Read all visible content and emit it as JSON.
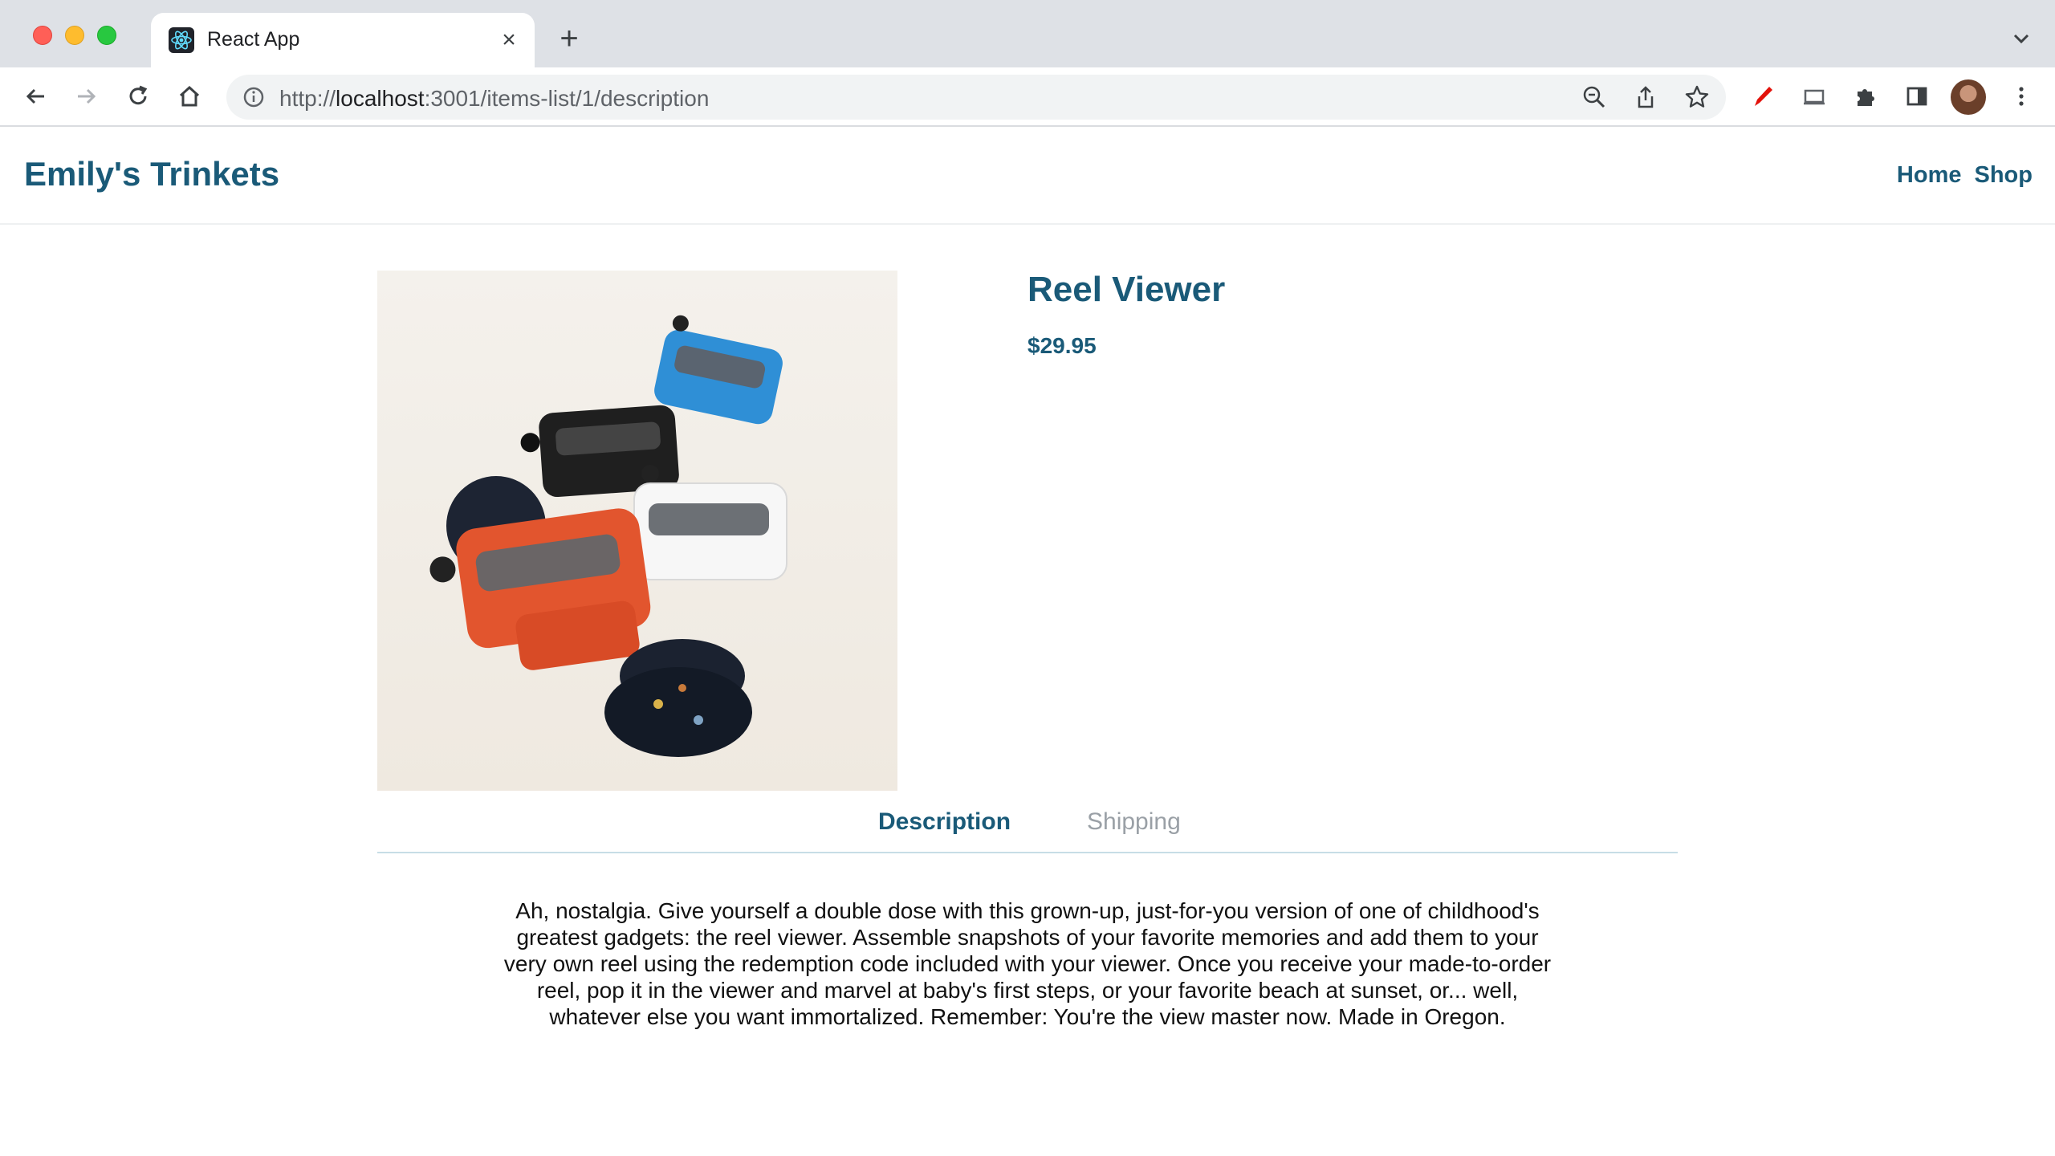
{
  "browser": {
    "tab_title": "React App",
    "url_scheme": "http://",
    "url_host": "localhost",
    "url_rest": ":3001/items-list/1/description"
  },
  "site": {
    "brand": "Emily's Trinkets",
    "nav": [
      "Home",
      "Shop"
    ]
  },
  "product": {
    "title": "Reel Viewer",
    "price": "$29.95",
    "tabs": [
      "Description",
      "Shipping"
    ],
    "active_tab": "Description",
    "description": "Ah, nostalgia. Give yourself a double dose with this grown-up, just-for-you version of one of childhood's greatest gadgets: the reel viewer. Assemble snapshots of your favorite memories and add them to your very own reel using the redemption code included with your viewer. Once you receive your made-to-order reel, pop it in the viewer and marvel at baby's first steps, or your favorite beach at sunset, or... well, whatever else you want immortalized. Remember: You're the view master now. Made in Oregon."
  },
  "colors": {
    "accent": "#1a5a78",
    "inactive_tab": "#9aa0a6"
  }
}
